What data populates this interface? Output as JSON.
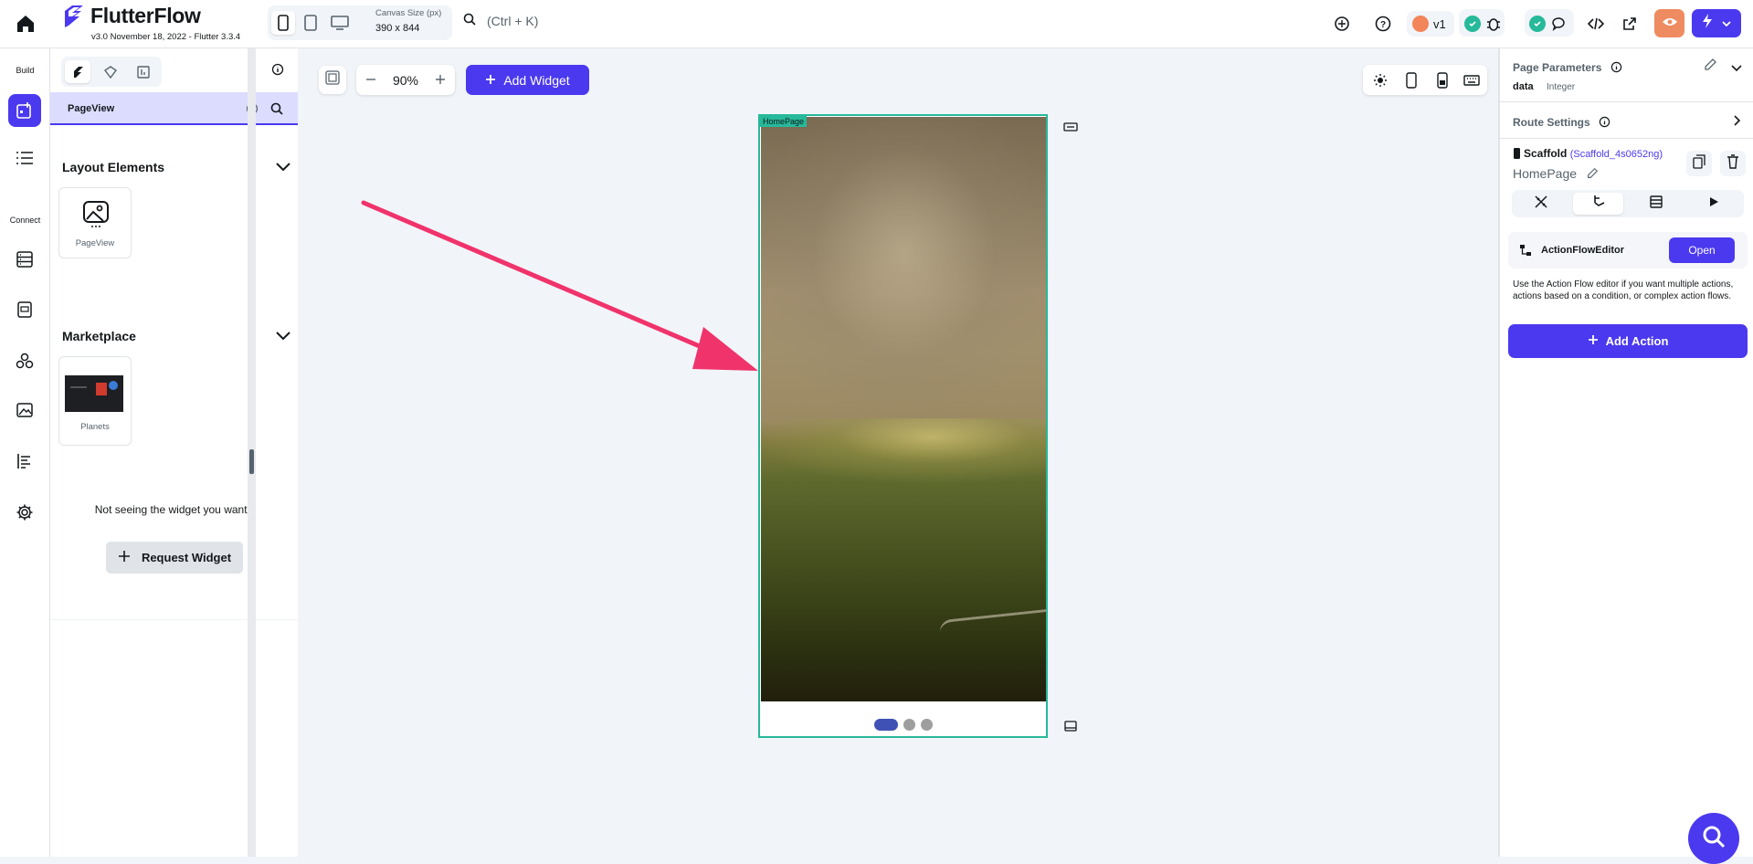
{
  "app": {
    "title": "FlutterFlow",
    "version": "v3.0 November 18, 2022 - Flutter 3.3.4"
  },
  "topbar": {
    "canvas_size_label": "Canvas Size (px)",
    "canvas_size_value": "390 x 844",
    "search_shortcut": "(Ctrl + K)",
    "version_badge": "v1"
  },
  "left_rail": {
    "build_label": "Build",
    "connect_label": "Connect"
  },
  "widget_panel": {
    "search_value": "PageView",
    "layout_section_title": "Layout Elements",
    "layout_items": [
      {
        "label": "PageView"
      }
    ],
    "marketplace_section_title": "Marketplace",
    "marketplace_items": [
      {
        "label": "Planets"
      }
    ],
    "not_seeing_text": "Not seeing the widget you want?",
    "request_widget_label": "Request Widget"
  },
  "canvas": {
    "zoom": "90%",
    "add_widget_label": "Add Widget",
    "page_tag": "HomePage",
    "page_indicator": {
      "count": 3,
      "active_index": 0
    }
  },
  "properties": {
    "page_parameters_title": "Page Parameters",
    "param_name": "data",
    "param_type": "Integer",
    "route_settings_title": "Route Settings",
    "scaffold_label": "Scaffold",
    "scaffold_id": "(Scaffold_4s0652ng)",
    "page_name": "HomePage",
    "action_flow_editor_label": "ActionFlowEditor",
    "open_label": "Open",
    "action_flow_help": "Use the Action Flow editor if you want multiple actions, actions based on a condition, or complex action flows.",
    "add_action_label": "Add Action"
  },
  "colors": {
    "primary": "#4b39ef",
    "selection": "#26b99a",
    "preview": "#ee8b60",
    "annotation_arrow": "#f0336b"
  }
}
